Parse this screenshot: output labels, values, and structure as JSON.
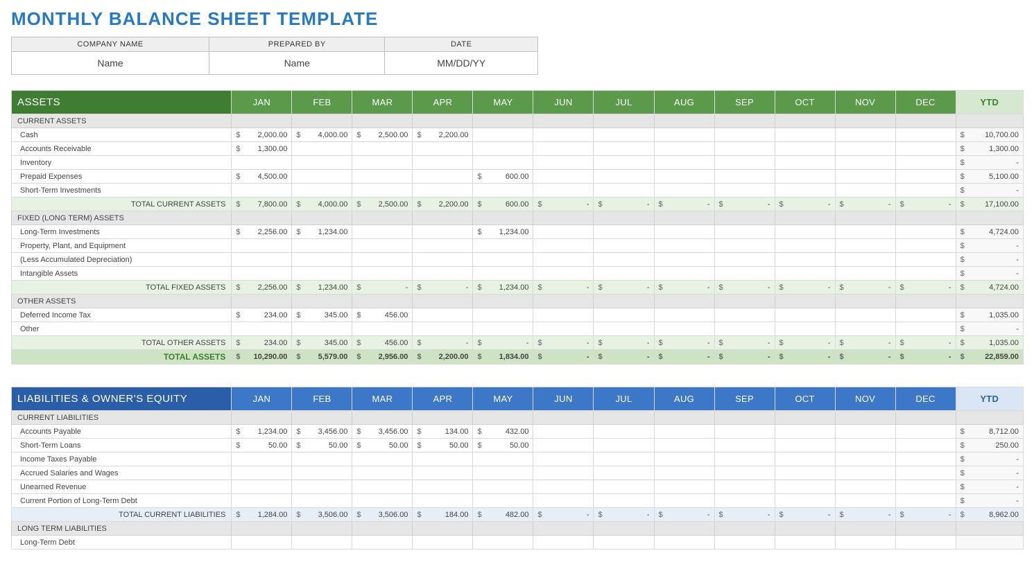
{
  "title": "MONTHLY BALANCE SHEET TEMPLATE",
  "info": {
    "headers": [
      "COMPANY NAME",
      "PREPARED BY",
      "DATE"
    ],
    "values": [
      "Name",
      "Name",
      "MM/DD/YY"
    ]
  },
  "months": [
    "JAN",
    "FEB",
    "MAR",
    "APR",
    "MAY",
    "JUN",
    "JUL",
    "AUG",
    "SEP",
    "OCT",
    "NOV",
    "DEC"
  ],
  "ytd_label": "YTD",
  "assets": {
    "title": "ASSETS",
    "sections": [
      {
        "name": "CURRENT ASSETS",
        "rows": [
          {
            "name": "Cash",
            "m": [
              "2,000.00",
              "4,000.00",
              "2,500.00",
              "2,200.00",
              "",
              "",
              "",
              "",
              "",
              "",
              "",
              ""
            ],
            "ytd": "10,700.00"
          },
          {
            "name": "Accounts Receivable",
            "m": [
              "1,300.00",
              "",
              "",
              "",
              "",
              "",
              "",
              "",
              "",
              "",
              "",
              ""
            ],
            "ytd": "1,300.00"
          },
          {
            "name": "Inventory",
            "m": [
              "",
              "",
              "",
              "",
              "",
              "",
              "",
              "",
              "",
              "",
              "",
              ""
            ],
            "ytd": "-"
          },
          {
            "name": "Prepaid Expenses",
            "m": [
              "4,500.00",
              "",
              "",
              "",
              "600.00",
              "",
              "",
              "",
              "",
              "",
              "",
              ""
            ],
            "ytd": "5,100.00"
          },
          {
            "name": "Short-Term Investments",
            "m": [
              "",
              "",
              "",
              "",
              "",
              "",
              "",
              "",
              "",
              "",
              "",
              ""
            ],
            "ytd": "-"
          }
        ],
        "subtotal": {
          "name": "TOTAL CURRENT ASSETS",
          "m": [
            "7,800.00",
            "4,000.00",
            "2,500.00",
            "2,200.00",
            "600.00",
            "-",
            "-",
            "-",
            "-",
            "-",
            "-",
            "-"
          ],
          "ytd": "17,100.00"
        }
      },
      {
        "name": "FIXED (LONG TERM) ASSETS",
        "rows": [
          {
            "name": "Long-Term Investments",
            "m": [
              "2,256.00",
              "1,234.00",
              "",
              "",
              "1,234.00",
              "",
              "",
              "",
              "",
              "",
              "",
              ""
            ],
            "ytd": "4,724.00"
          },
          {
            "name": "Property, Plant, and Equipment",
            "m": [
              "",
              "",
              "",
              "",
              "",
              "",
              "",
              "",
              "",
              "",
              "",
              ""
            ],
            "ytd": "-"
          },
          {
            "name": "(Less Accumulated Depreciation)",
            "m": [
              "",
              "",
              "",
              "",
              "",
              "",
              "",
              "",
              "",
              "",
              "",
              ""
            ],
            "ytd": "-"
          },
          {
            "name": "Intangible Assets",
            "m": [
              "",
              "",
              "",
              "",
              "",
              "",
              "",
              "",
              "",
              "",
              "",
              ""
            ],
            "ytd": "-"
          }
        ],
        "subtotal": {
          "name": "TOTAL FIXED ASSETS",
          "m": [
            "2,256.00",
            "1,234.00",
            "-",
            "-",
            "1,234.00",
            "-",
            "-",
            "-",
            "-",
            "-",
            "-",
            "-"
          ],
          "ytd": "4,724.00"
        }
      },
      {
        "name": "OTHER ASSETS",
        "rows": [
          {
            "name": "Deferred Income Tax",
            "m": [
              "234.00",
              "345.00",
              "456.00",
              "",
              "",
              "",
              "",
              "",
              "",
              "",
              "",
              ""
            ],
            "ytd": "1,035.00"
          },
          {
            "name": "Other",
            "m": [
              "",
              "",
              "",
              "",
              "",
              "",
              "",
              "",
              "",
              "",
              "",
              ""
            ],
            "ytd": "-"
          }
        ],
        "subtotal": {
          "name": "TOTAL OTHER ASSETS",
          "m": [
            "234.00",
            "345.00",
            "456.00",
            "-",
            "-",
            "-",
            "-",
            "-",
            "-",
            "-",
            "-",
            "-"
          ],
          "ytd": "1,035.00"
        }
      }
    ],
    "grand": {
      "name": "TOTAL ASSETS",
      "m": [
        "10,290.00",
        "5,579.00",
        "2,956.00",
        "2,200.00",
        "1,834.00",
        "-",
        "-",
        "-",
        "-",
        "-",
        "-",
        "-"
      ],
      "ytd": "22,859.00"
    }
  },
  "liabilities": {
    "title": "LIABILITIES & OWNER'S EQUITY",
    "sections": [
      {
        "name": "CURRENT LIABILITIES",
        "rows": [
          {
            "name": "Accounts Payable",
            "m": [
              "1,234.00",
              "3,456.00",
              "3,456.00",
              "134.00",
              "432.00",
              "",
              "",
              "",
              "",
              "",
              "",
              ""
            ],
            "ytd": "8,712.00"
          },
          {
            "name": "Short-Term Loans",
            "m": [
              "50.00",
              "50.00",
              "50.00",
              "50.00",
              "50.00",
              "",
              "",
              "",
              "",
              "",
              "",
              ""
            ],
            "ytd": "250.00"
          },
          {
            "name": "Income Taxes Payable",
            "m": [
              "",
              "",
              "",
              "",
              "",
              "",
              "",
              "",
              "",
              "",
              "",
              ""
            ],
            "ytd": "-"
          },
          {
            "name": "Accrued Salaries and Wages",
            "m": [
              "",
              "",
              "",
              "",
              "",
              "",
              "",
              "",
              "",
              "",
              "",
              ""
            ],
            "ytd": "-"
          },
          {
            "name": "Unearned Revenue",
            "m": [
              "",
              "",
              "",
              "",
              "",
              "",
              "",
              "",
              "",
              "",
              "",
              ""
            ],
            "ytd": "-"
          },
          {
            "name": "Current Portion of Long-Term Debt",
            "m": [
              "",
              "",
              "",
              "",
              "",
              "",
              "",
              "",
              "",
              "",
              "",
              ""
            ],
            "ytd": "-"
          }
        ],
        "subtotal": {
          "name": "TOTAL CURRENT LIABILITIES",
          "m": [
            "1,284.00",
            "3,506.00",
            "3,506.00",
            "184.00",
            "482.00",
            "-",
            "-",
            "-",
            "-",
            "-",
            "-",
            "-"
          ],
          "ytd": "8,962.00"
        }
      },
      {
        "name": "LONG TERM LIABILITIES",
        "rows": [
          {
            "name": "Long-Term Debt",
            "m": [
              "",
              "",
              "",
              "",
              "",
              "",
              "",
              "",
              "",
              "",
              "",
              ""
            ],
            "ytd": ""
          }
        ]
      }
    ]
  }
}
